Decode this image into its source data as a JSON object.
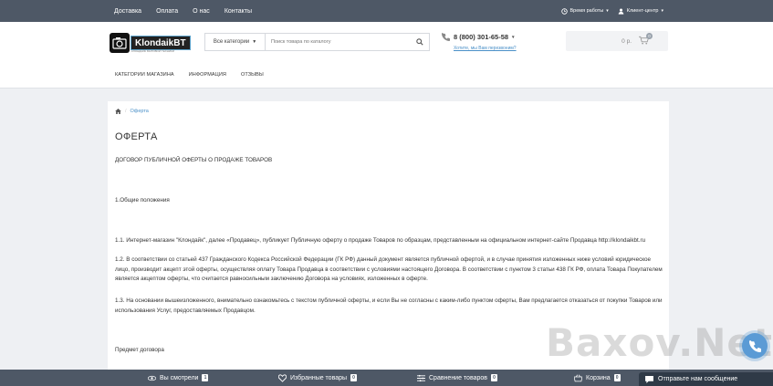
{
  "topbar": {
    "nav": [
      "Доставка",
      "Оплата",
      "О нас",
      "Контакты"
    ],
    "work_hours": "Время работы",
    "client_center": "Клиент-центр"
  },
  "header": {
    "logo_text": "KlondaikBT",
    "logo_sub": "КЛОНДАЙК БЫТОВОЙ ТЕХНИКИ",
    "search": {
      "category": "Все категории",
      "placeholder": "Поиск товара по каталогу"
    },
    "phone": "8 (800) 301-65-58",
    "callback": "Хотите, мы Вам перезвоним?",
    "cart_total": "0 р.",
    "cart_count": "0"
  },
  "catnav": [
    "Категории магазина",
    "Информация",
    "Отзывы"
  ],
  "breadcrumb": {
    "current": "Оферта"
  },
  "page": {
    "title": "ОФЕРТА",
    "paragraphs": [
      "ДОГОВОР ПУБЛИЧНОЙ ОФЕРТЫ О ПРОДАЖЕ ТОВАРОВ",
      "1.Общие положения",
      "1.1. Интернет-магазин \"Клондайк\", далее «Продавец», публикует Публичную оферту о продаже Товаров по образцам, представленным на официальном интернет-сайте Продавца http://klondaikbt.ru",
      "1.2. В соответствии со статьей 437 Гражданского Кодекса Российской Федерации (ГК РФ) данный документ является публичной офертой, и в случае принятия изложенных ниже условий юридическое лицо, производит акцепт этой оферты, осуществляя оплату Товара Продавца в соответствии с условиями настоящего Договора. В соответствии с пунктом 3 статьи 438 ГК РФ, оплата Товара Покупателем является акцептом оферты, что считается равносильным заключению Договора на условиях, изложенных в оферте.",
      "1.3. На основании вышеизложенного, внимательно ознакомьтесь с текстом публичной оферты, и если Вы не согласны с каким-либо пунктом оферты, Вам предлагается отказаться от покупки Товаров или использования Услуг, предоставляемых Продавцом.",
      "Предмет договора"
    ]
  },
  "bottombar": {
    "viewed": {
      "label": "Вы смотрели",
      "count": "1"
    },
    "wishlist": {
      "label": "Избранные товары",
      "count": "0"
    },
    "compare": {
      "label": "Сравнение товаров",
      "count": "0"
    },
    "cart": {
      "label": "Корзина",
      "count": "0"
    }
  },
  "chat": {
    "label": "Отправьте нам сообщение"
  },
  "watermark": "Baxov.Net"
}
